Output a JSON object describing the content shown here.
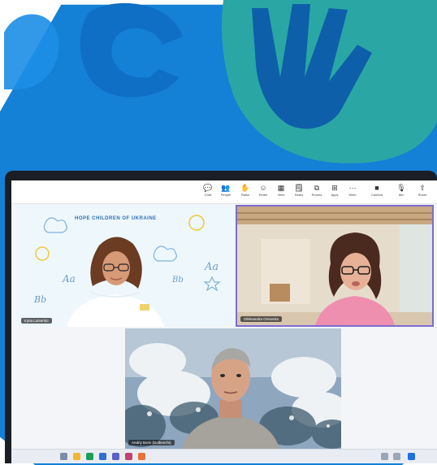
{
  "toolbar": {
    "items": [
      {
        "label": "Chat",
        "icon": "chat-icon",
        "glyph": "💬"
      },
      {
        "label": "People",
        "icon": "people-icon",
        "glyph": "👥"
      },
      {
        "label": "Raise",
        "icon": "raise-hand-icon",
        "glyph": "✋"
      },
      {
        "label": "React",
        "icon": "react-icon",
        "glyph": "☺"
      },
      {
        "label": "View",
        "icon": "view-icon",
        "glyph": "▦"
      },
      {
        "label": "Notes",
        "icon": "notes-icon",
        "glyph": "🗒"
      },
      {
        "label": "Rooms",
        "icon": "rooms-icon",
        "glyph": "⧉"
      },
      {
        "label": "Apps",
        "icon": "apps-icon",
        "glyph": "⊞"
      },
      {
        "label": "More",
        "icon": "more-icon",
        "glyph": "⋯"
      },
      {
        "label": "Camera",
        "icon": "camera-icon",
        "glyph": "■"
      },
      {
        "label": "Mic",
        "icon": "mic-icon",
        "glyph": "🎙"
      },
      {
        "label": "Share",
        "icon": "share-icon",
        "glyph": "⇧"
      }
    ]
  },
  "tiles": [
    {
      "name": "Iryna Lutsenko",
      "banner": "HOPE CHILDREN OF UKRAINE"
    },
    {
      "name": "Oleksandra Onisenko"
    },
    {
      "name": "Andriy Boriv (Dolbeezhi)"
    }
  ],
  "colors": {
    "hexagon": "#1480d6",
    "logo_teal": "#2aa7a5",
    "logo_shadow": "#0e5fa9",
    "accent_purple": "#7a6cd0",
    "leave_red": "#d13438"
  }
}
